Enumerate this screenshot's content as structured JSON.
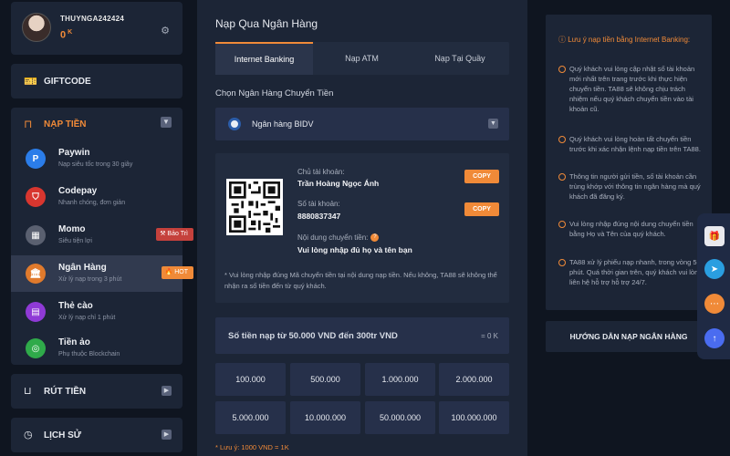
{
  "user": {
    "name": "THUYNGA242424",
    "balance": "0",
    "balance_unit": "K"
  },
  "sidebar": {
    "giftcode": "GIFTCODE",
    "nap_tien": "NẠP TIỀN",
    "rut_tien": "RÚT TIỀN",
    "lich_su": "LỊCH SỬ",
    "methods": [
      {
        "name": "Paywin",
        "desc": "Nạp siêu tốc trong 30 giây"
      },
      {
        "name": "Codepay",
        "desc": "Nhanh chóng, đơn giản"
      },
      {
        "name": "Momo",
        "desc": "Siêu tiện lợi",
        "badge": "Bảo Trì"
      },
      {
        "name": "Ngân Hàng",
        "desc": "Xử lý nạp trong 3 phút",
        "badge": "HOT"
      },
      {
        "name": "Thẻ cào",
        "desc": "Xử lý nạp chỉ 1 phút"
      },
      {
        "name": "Tiền ảo",
        "desc": "Phụ thuộc Blockchain"
      }
    ]
  },
  "main": {
    "title": "Nạp Qua Ngân Hàng",
    "tabs": [
      "Internet Banking",
      "Nạp ATM",
      "Nạp Tại Quầy"
    ],
    "choose_bank_label": "Chọn Ngân Hàng Chuyển Tiền",
    "selected_bank": "Ngân hàng BIDV",
    "account_holder_label": "Chủ tài khoản:",
    "account_holder": "Trần Hoàng Ngọc Ánh",
    "account_number_label": "Số tài khoản:",
    "account_number": "8880837347",
    "transfer_content_label": "Nội dung chuyển tiền:",
    "transfer_content": "Vui lòng nhập đủ họ và tên bạn",
    "copy_label": "COPY",
    "note": "* Vui lòng nhập đúng Mã chuyển tiền tại nội dung nạp tiền. Nếu không, TA88 sẽ không thể nhận ra số tiền đến từ quý khách.",
    "amount_placeholder": "Số tiền nạp từ 50.000 VND đến 300tr VND",
    "amount_value": "= 0 K",
    "amounts": [
      "100.000",
      "500.000",
      "1.000.000",
      "2.000.000",
      "5.000.000",
      "10.000.000",
      "50.000.000",
      "100.000.000"
    ],
    "footnote": "* Lưu ý: 1000 VND = 1K"
  },
  "right_panel": {
    "title": "Lưu ý nạp tiền bằng Internet Banking:",
    "items": [
      "Quý khách vui lòng cập nhật số tài khoản mới nhất trên trang trước khi thực hiện chuyển tiền. TA88 sẽ không chịu trách nhiệm nếu quý khách chuyển tiền vào tài khoản cũ.",
      "Quý khách vui lòng hoàn tất chuyển tiền trước khi xác nhận lệnh nạp tiền trên TA88.",
      "Thông tin người gửi tiền, số tài khoản cần trùng khớp với thông tin ngân hàng mà quý khách đã đăng ký.",
      "Vui lòng nhập đúng nội dung chuyển tiền bằng Họ và Tên của quý khách.",
      "TA88 xử lý phiếu nạp nhanh, trong vòng 5 phút. Quá thời gian trên, quý khách vui lòng liên hệ hỗ trợ hỗ trợ 24/7."
    ],
    "guide_button": "HƯỚNG DẪN NẠP NGÂN HÀNG"
  },
  "colors": {
    "accent": "#f08a38",
    "panel": "#1c2536",
    "bg": "#0f1520",
    "maintenance": "#c5413c"
  }
}
